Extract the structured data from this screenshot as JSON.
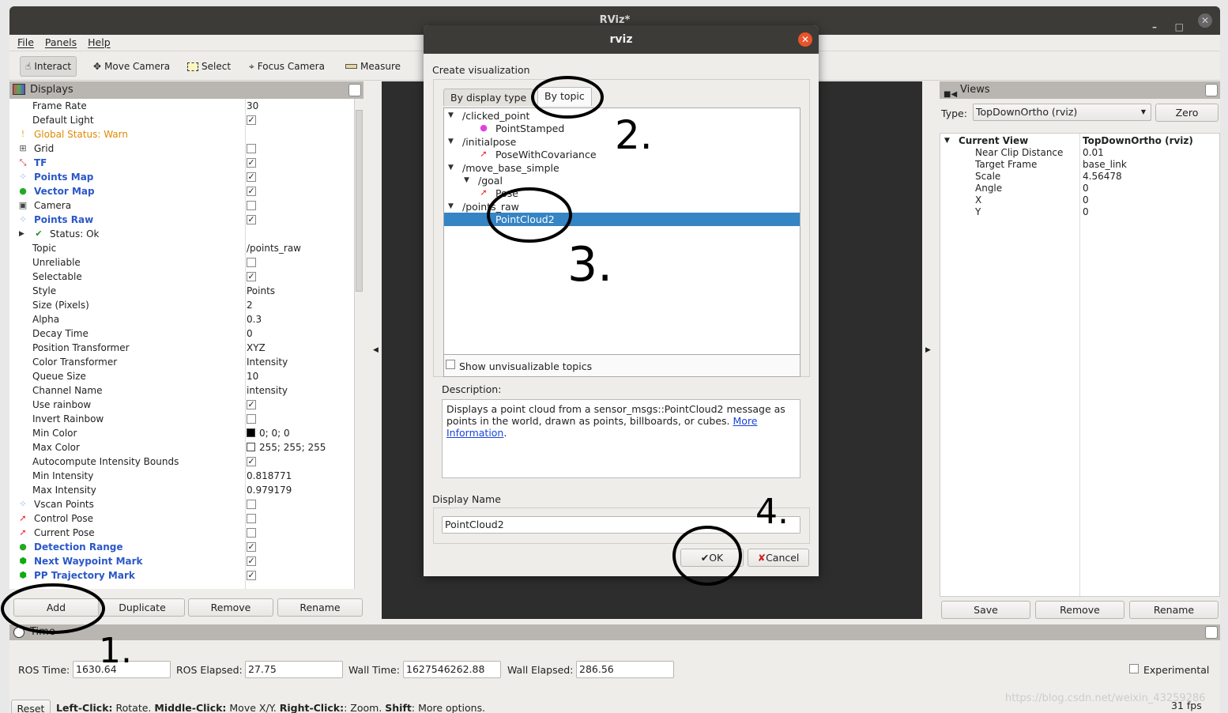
{
  "window": {
    "title": "RViz*",
    "controls": [
      "–",
      "□",
      "✕"
    ]
  },
  "menu": [
    "File",
    "Panels",
    "Help"
  ],
  "toolbar": [
    {
      "label": "Interact",
      "icon": "hand-icon",
      "active": true
    },
    {
      "label": "Move Camera",
      "icon": "move-camera-icon"
    },
    {
      "label": "Select",
      "icon": "select-icon"
    },
    {
      "label": "Focus Camera",
      "icon": "focus-camera-icon"
    },
    {
      "label": "Measure",
      "icon": "ruler-icon"
    }
  ],
  "displays": {
    "title": "Displays",
    "rows": [
      {
        "label": "Frame Rate",
        "value": "30",
        "indent": 1
      },
      {
        "label": "Default Light",
        "check": true,
        "indent": 1
      },
      {
        "label": "Global Status: Warn",
        "style": "warn",
        "icon": "warning-icon",
        "indent": 1
      },
      {
        "label": "Grid",
        "check": false,
        "icon": "grid-icon",
        "indent": 1
      },
      {
        "label": "TF",
        "check": true,
        "style": "blue",
        "icon": "tf-icon",
        "indent": 1
      },
      {
        "label": "Points Map",
        "check": true,
        "style": "blue",
        "icon": "pointcloud-icon",
        "indent": 1
      },
      {
        "label": "Vector Map",
        "check": true,
        "style": "blue",
        "icon": "marker-icon",
        "indent": 1
      },
      {
        "label": "Camera",
        "check": false,
        "icon": "camera-icon",
        "indent": 1
      },
      {
        "label": "Points Raw",
        "check": true,
        "style": "blue",
        "icon": "pointcloud-icon",
        "indent": 1
      },
      {
        "label": "Status: Ok",
        "icon": "check-icon",
        "indent": 2,
        "expand": true
      },
      {
        "label": "Topic",
        "value": "/points_raw",
        "indent": 1
      },
      {
        "label": "Unreliable",
        "check": false,
        "indent": 1
      },
      {
        "label": "Selectable",
        "check": true,
        "indent": 1
      },
      {
        "label": "Style",
        "value": "Points",
        "indent": 1
      },
      {
        "label": "Size (Pixels)",
        "value": "2",
        "indent": 1
      },
      {
        "label": "Alpha",
        "value": "0.3",
        "indent": 1
      },
      {
        "label": "Decay Time",
        "value": "0",
        "indent": 1
      },
      {
        "label": "Position Transformer",
        "value": "XYZ",
        "indent": 1
      },
      {
        "label": "Color Transformer",
        "value": "Intensity",
        "indent": 1
      },
      {
        "label": "Queue Size",
        "value": "10",
        "indent": 1
      },
      {
        "label": "Channel Name",
        "value": "intensity",
        "indent": 1
      },
      {
        "label": "Use rainbow",
        "check": true,
        "indent": 1
      },
      {
        "label": "Invert Rainbow",
        "check": false,
        "indent": 1
      },
      {
        "label": "Min Color",
        "value": "0; 0; 0",
        "swatch": "#000000",
        "indent": 1
      },
      {
        "label": "Max Color",
        "value": "255; 255; 255",
        "swatch": "#ffffff",
        "indent": 1
      },
      {
        "label": "Autocompute Intensity Bounds",
        "check": true,
        "indent": 1
      },
      {
        "label": "Min Intensity",
        "value": "0.818771",
        "indent": 1
      },
      {
        "label": "Max Intensity",
        "value": "0.979179",
        "indent": 1
      },
      {
        "label": "Vscan Points",
        "check": false,
        "icon": "pointcloud-icon",
        "indent": 1
      },
      {
        "label": "Control Pose",
        "check": false,
        "icon": "pose-icon",
        "indent": 1
      },
      {
        "label": "Current Pose",
        "check": false,
        "icon": "pose-icon",
        "indent": 1
      },
      {
        "label": "Detection Range",
        "check": true,
        "style": "blue",
        "icon": "marker-icon",
        "indent": 1
      },
      {
        "label": "Next Waypoint Mark",
        "check": true,
        "style": "blue",
        "icon": "marker-green-icon",
        "indent": 1
      },
      {
        "label": "PP Trajectory Mark",
        "check": true,
        "style": "blue",
        "icon": "marker-green-icon",
        "indent": 1
      }
    ],
    "buttons": [
      "Add",
      "Duplicate",
      "Remove",
      "Rename"
    ]
  },
  "views": {
    "title": "Views",
    "type_label": "Type:",
    "type_value": "TopDownOrtho (rviz)",
    "zero": "Zero",
    "current": {
      "label": "Current View",
      "value": "TopDownOrtho (rviz)"
    },
    "props": [
      {
        "k": "Near Clip Distance",
        "v": "0.01"
      },
      {
        "k": "Target Frame",
        "v": "base_link"
      },
      {
        "k": "Scale",
        "v": "4.56478"
      },
      {
        "k": "Angle",
        "v": "0"
      },
      {
        "k": "X",
        "v": "0"
      },
      {
        "k": "Y",
        "v": "0"
      }
    ],
    "buttons": [
      "Save",
      "Remove",
      "Rename"
    ]
  },
  "time": {
    "title": "Time",
    "ros_time_label": "ROS Time:",
    "ros_time": "1630.64",
    "ros_elapsed_label": "ROS Elapsed:",
    "ros_elapsed": "27.75",
    "wall_time_label": "Wall Time:",
    "wall_time": "1627546262.88",
    "wall_elapsed_label": "Wall Elapsed:",
    "wall_elapsed": "286.56",
    "experimental": "Experimental"
  },
  "status": {
    "reset": "Reset",
    "b1": "Left-Click:",
    "t1": " Rotate. ",
    "b2": "Middle-Click:",
    "t2": " Move X/Y. ",
    "b3": "Right-Click:",
    "t3": ": Zoom. ",
    "b4": "Shift",
    "t4": ": More options.",
    "fps": "31 fps",
    "watermark": "https://blog.csdn.net/weixin_43259286"
  },
  "dialog": {
    "title": "rviz",
    "heading": "Create visualization",
    "tabs": [
      "By display type",
      "By topic"
    ],
    "topics": [
      {
        "label": "/clicked_point",
        "level": 0
      },
      {
        "label": "PointStamped",
        "level": 2,
        "icon": "point-icon"
      },
      {
        "label": "/initialpose",
        "level": 0
      },
      {
        "label": "PoseWithCovariance",
        "level": 2,
        "icon": "pose-icon"
      },
      {
        "label": "/move_base_simple",
        "level": 0
      },
      {
        "label": "/goal",
        "level": 1
      },
      {
        "label": "Pose",
        "level": 2,
        "icon": "pose-icon"
      },
      {
        "label": "/points_raw",
        "level": 0
      },
      {
        "label": "PointCloud2",
        "level": 2,
        "icon": "pointcloud-icon",
        "selected": true
      }
    ],
    "show_unvis": "Show unvisualizable topics",
    "desc_label": "Description:",
    "desc_text": "Displays a point cloud from a sensor_msgs::PointCloud2 message as points in the world, drawn as points, billboards, or cubes. ",
    "desc_link": "More Information",
    "name_label": "Display Name",
    "name_value": "PointCloud2",
    "ok": "OK",
    "cancel": "Cancel"
  },
  "annotations": [
    "1.",
    "2.",
    "3.",
    "4."
  ]
}
